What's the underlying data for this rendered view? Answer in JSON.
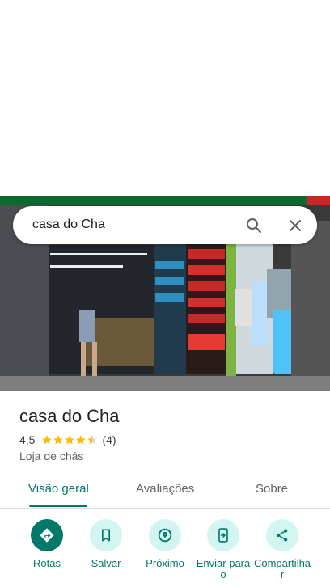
{
  "search": {
    "query": "casa do Cha"
  },
  "place": {
    "name": "casa do Cha",
    "rating": "4,5",
    "stars": 4.5,
    "review_count": "(4)",
    "category": "Loja de chás"
  },
  "tabs": [
    {
      "label": "Visão geral",
      "active": true
    },
    {
      "label": "Avaliações",
      "active": false
    },
    {
      "label": "Sobre",
      "active": false
    }
  ],
  "actions": [
    {
      "label": "Rotas",
      "icon": "directions-icon"
    },
    {
      "label": "Salvar",
      "icon": "bookmark-icon"
    },
    {
      "label": "Próximo",
      "icon": "nearby-icon"
    },
    {
      "label": "Enviar para o",
      "icon": "send-to-phone-icon"
    },
    {
      "label": "Compartilhar",
      "icon": "share-icon"
    }
  ],
  "colors": {
    "accent": "#00796b",
    "accent_light": "#d2f5f2",
    "star": "#fbbc04"
  }
}
